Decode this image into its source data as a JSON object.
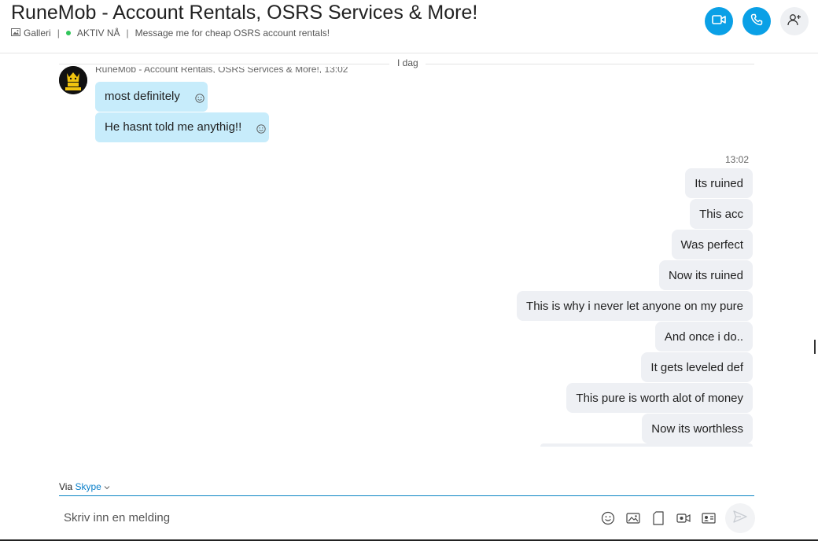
{
  "header": {
    "title": "RuneMob - Account Rentals, OSRS Services & More!",
    "gallery_label": "Galleri",
    "status_label": "AKTIV NÅ",
    "mood_message": "Message me for cheap OSRS account rentals!",
    "buttons": [
      {
        "icon": "video-call-icon"
      },
      {
        "icon": "audio-call-icon"
      },
      {
        "icon": "add-people-icon"
      }
    ],
    "accent_color": "#0aa0e6"
  },
  "chat": {
    "day_separator": "I dag",
    "incoming": {
      "sender_line": "RuneMob - Account Rentals, OSRS Services & More!, 13:02",
      "messages": [
        "most definitely",
        "He hasnt told me anythig!!"
      ]
    },
    "outgoing": {
      "time": "13:02",
      "messages": [
        "Its ruined",
        "This acc",
        "Was perfect",
        "Now its ruined",
        "This is why i never let anyone on my pure",
        "And once i do..",
        "It gets leveled def",
        "This pure is worth alot of money",
        "Now its worthless"
      ]
    }
  },
  "composer": {
    "via_label": "Via",
    "via_service": "Skype",
    "placeholder": "Skriv inn en melding",
    "tools": [
      "emoji-icon",
      "image-icon",
      "file-icon",
      "video-message-icon",
      "contact-card-icon"
    ],
    "send_icon": "send-icon"
  }
}
